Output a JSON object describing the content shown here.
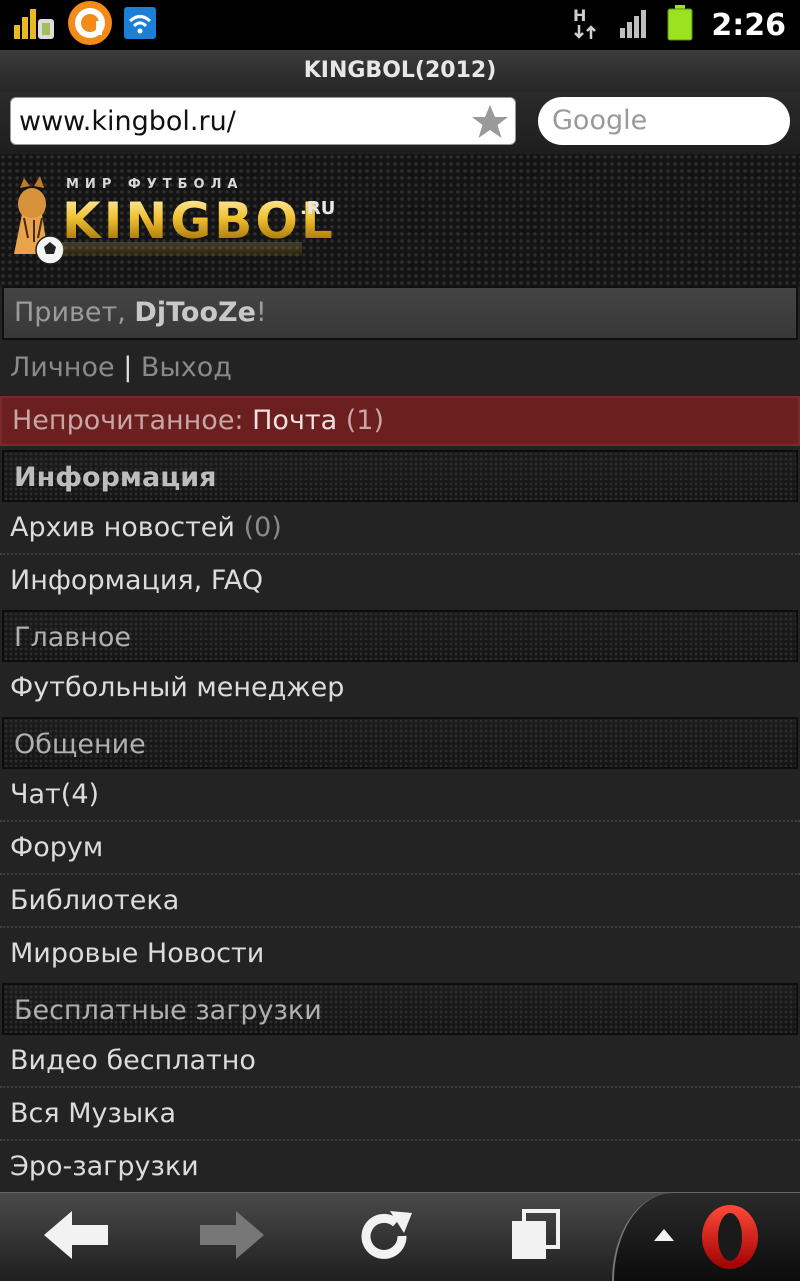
{
  "status_bar": {
    "time": "2:26",
    "icons": [
      "notification-bars-icon",
      "app-a-icon",
      "wifi-icon",
      "h-data-icon",
      "signal-icon",
      "battery-icon"
    ]
  },
  "browser": {
    "title": "KINGBOL(2012)",
    "url": "www.kingbol.ru/",
    "search_placeholder": "Google"
  },
  "logo": {
    "tagline": "МИР ФУТБОЛА",
    "name": "KINGBOL",
    "suffix": ".RU"
  },
  "greeting": {
    "prefix": "Привет, ",
    "username": "DjTooZe",
    "suffix": "!"
  },
  "user_links": {
    "personal": "Личное",
    "separator": "|",
    "logout": "Выход"
  },
  "unread": {
    "label": "Непрочитанное: ",
    "mail": "Почта",
    "count": " (1)"
  },
  "menu": {
    "info_header": "Информация",
    "news_archive": "Архив новостей",
    "news_archive_count": "(0)",
    "faq": "Информация, FAQ",
    "main_header": "Главное",
    "football_manager": "Футбольный менеджер",
    "social_header": "Общение",
    "chat": "Чат(4)",
    "forum": "Форум",
    "library": "Библиотека",
    "world_news": "Мировые Новости",
    "downloads_header": "Бесплатные загрузки",
    "video": "Видео бесплатно",
    "music": "Вся Музыка",
    "ero": "Эро-загрузки"
  },
  "colors": {
    "unread_bg": "#6b1f1f",
    "page_bg": "#232323",
    "opera_red": "#d10a0a"
  }
}
